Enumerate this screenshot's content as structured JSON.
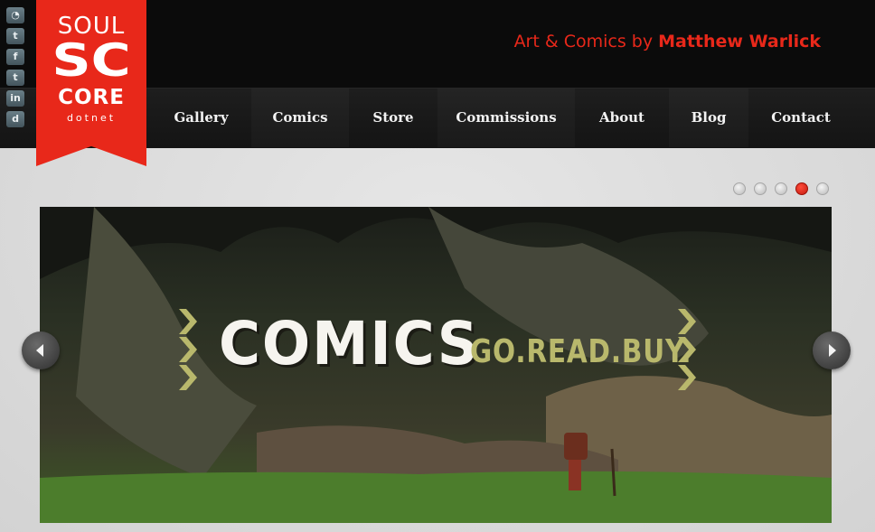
{
  "social_icons": [
    {
      "name": "rss-icon",
      "glyph": "◔"
    },
    {
      "name": "twitter-icon",
      "glyph": "t"
    },
    {
      "name": "facebook-icon",
      "glyph": "f"
    },
    {
      "name": "tumblr-icon",
      "glyph": "t"
    },
    {
      "name": "linkedin-icon",
      "glyph": "in"
    },
    {
      "name": "deviantart-icon",
      "glyph": "d"
    }
  ],
  "logo": {
    "line1": "SOUL",
    "mark": "SC",
    "line2": "CORE",
    "line3": "dotnet"
  },
  "tagline": {
    "prefix": "Art & Comics by ",
    "name": "Matthew Warlick"
  },
  "nav": [
    "Gallery",
    "Comics",
    "Store",
    "Commissions",
    "About",
    "Blog",
    "Contact"
  ],
  "slider": {
    "slide_count": 5,
    "active_index": 3
  },
  "hero": {
    "headline": "COMICS",
    "subline": "GO.READ.BUY."
  },
  "colors": {
    "brand_red": "#e8281a",
    "nav_bg": "#161616",
    "sub_text": "#b9b86c"
  }
}
